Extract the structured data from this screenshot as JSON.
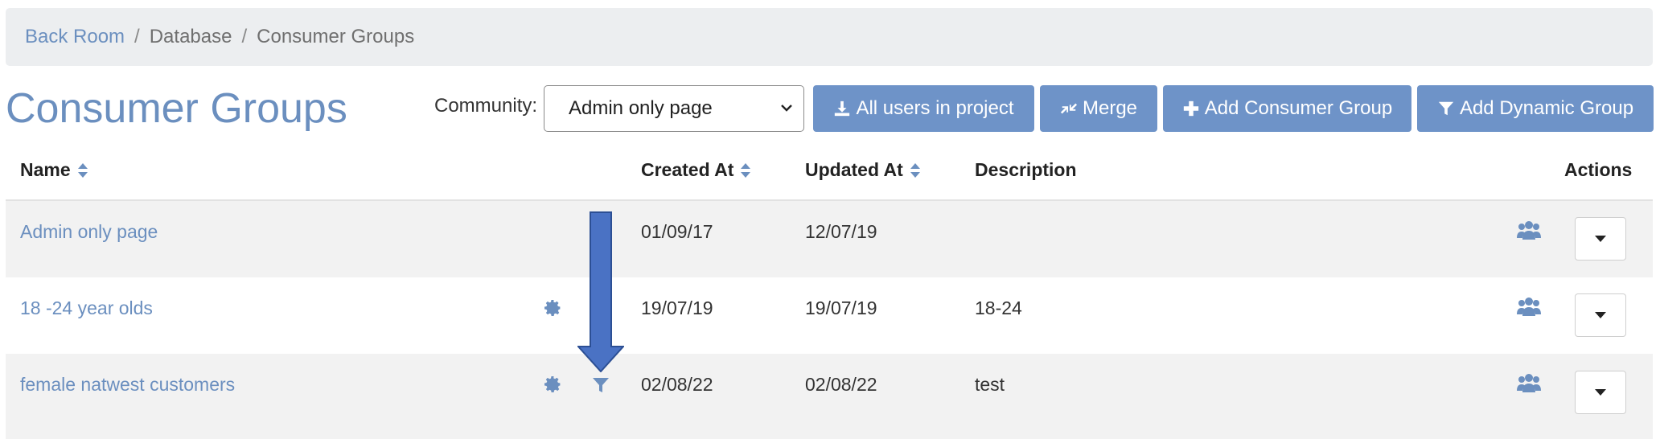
{
  "breadcrumb": {
    "items": [
      "Back Room",
      "Database",
      "Consumer Groups"
    ],
    "separator": "/"
  },
  "page": {
    "title": "Consumer Groups"
  },
  "community": {
    "label": "Community:",
    "selected": "Admin only page"
  },
  "toolbar": {
    "all_users": "All users in project",
    "merge": "Merge",
    "add_consumer_group": "Add Consumer Group",
    "add_dynamic_group": "Add Dynamic Group"
  },
  "table": {
    "headers": {
      "name": "Name",
      "created_at": "Created At",
      "updated_at": "Updated At",
      "description": "Description",
      "actions": "Actions"
    },
    "rows": [
      {
        "name": "Admin only page",
        "created": "01/09/17",
        "updated": "12/07/19",
        "description": "",
        "has_gear": false,
        "has_filter": false
      },
      {
        "name": "18 -24 year olds",
        "created": "19/07/19",
        "updated": "19/07/19",
        "description": "18-24",
        "has_gear": true,
        "has_filter": false
      },
      {
        "name": "female natwest customers",
        "created": "02/08/22",
        "updated": "02/08/22",
        "description": "test",
        "has_gear": true,
        "has_filter": true
      }
    ]
  },
  "icons": {
    "download": "download-icon",
    "merge": "compress-arrows-icon",
    "plus": "plus-icon",
    "filter": "filter-icon",
    "gear": "gear-icon",
    "users": "users-icon",
    "caret": "caret-down-icon",
    "sort": "sort-icon"
  },
  "colors": {
    "accent": "#6b8fbf",
    "button": "#6e93c8",
    "annotation_arrow": "#4a72c4"
  }
}
